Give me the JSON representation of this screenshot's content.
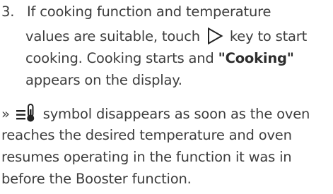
{
  "step": {
    "number": "3.",
    "line1": "If cooking function and temperature",
    "line2_before": "values are suitable, touch",
    "line2_after": "key to start",
    "line3_before": "cooking. Cooking starts and",
    "line3_bold": "\"Cooking\"",
    "line4": "appears on the display."
  },
  "note": {
    "prefix": "»",
    "line1_after": "symbol disappears as soon as the oven",
    "line2": "reaches the desired temperature and oven",
    "line3": "resumes operating in the function it was in",
    "line4": "before the Booster function."
  },
  "icons": {
    "start_key": "play-triangle-icon",
    "booster_symbol": "booster-heat-icon"
  },
  "colors": {
    "text": "#3d3d3d",
    "icon": "#222222"
  }
}
